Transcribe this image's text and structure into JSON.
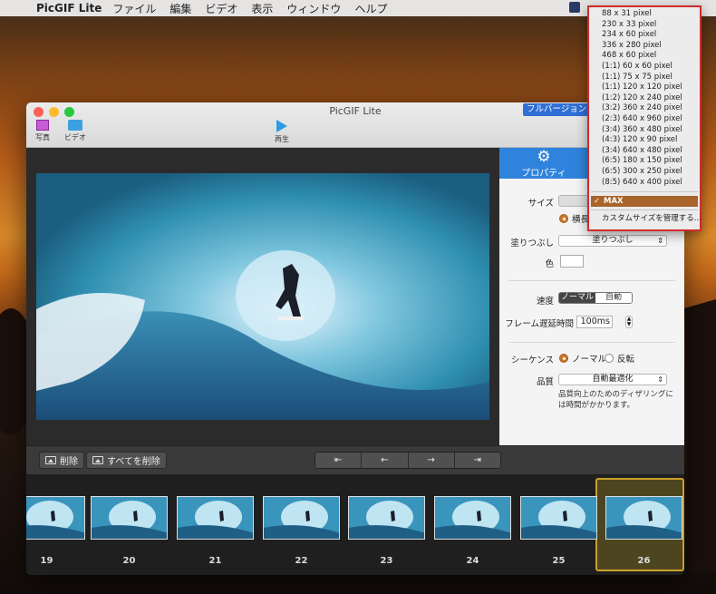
{
  "menubar": {
    "app_name": "PicGIF Lite",
    "items": [
      "ファイル",
      "編集",
      "ビデオ",
      "表示",
      "ウィンドウ",
      "ヘルプ"
    ]
  },
  "window": {
    "title": "PicGIF Lite",
    "upgrade_button": "フルバージョンへの",
    "toolbar": {
      "photo": "写真",
      "video": "ビデオ",
      "play": "再生"
    }
  },
  "panel": {
    "tab_properties": "プロパティ",
    "size_label": "サイズ",
    "size_radio": "横長",
    "fill_label": "塗りつぶし",
    "fill_value": "塗りつぶし",
    "color_label": "色",
    "speed_label": "速度",
    "speed_options": [
      "ノーマル",
      "自動"
    ],
    "frame_delay_label": "フレーム遅延時間",
    "frame_delay_value": "100",
    "frame_delay_unit": "ms",
    "sequence_label": "シーケンス",
    "sequence_normal": "ノーマル",
    "sequence_reverse": "反転",
    "quality_label": "品質",
    "quality_value": "自動最適化",
    "quality_note": "品質向上のためのディザリングには時間がかかります。"
  },
  "controls": {
    "delete": "削除",
    "delete_all": "すべてを削除",
    "nav": [
      "⇤",
      "←",
      "→",
      "⇥"
    ]
  },
  "timeline": {
    "frames": [
      "19",
      "20",
      "21",
      "22",
      "23",
      "24",
      "25",
      "26"
    ],
    "selected": "26"
  },
  "size_menu": {
    "items": [
      "88 x 31 pixel",
      "230 x 33 pixel",
      "234 x 60 pixel",
      "336 x 280 pixel",
      "468 x 60 pixel",
      "(1:1) 60 x 60 pixel",
      "(1:1) 75 x 75 pixel",
      "(1:1) 120 x 120 pixel",
      "(1:2) 120 x 240 pixel",
      "(3:2) 360 x 240 pixel",
      "(2:3) 640 x 960 pixel",
      "(3:4) 360 x 480 pixel",
      "(4:3) 120 x 90 pixel",
      "(3:4) 640 x 480 pixel",
      "(6:5) 180 x 150 pixel",
      "(6:5) 300 x 250 pixel",
      "(8:5) 640 x 400 pixel"
    ],
    "selected": "MAX",
    "manage": "カスタムサイズを管理する..."
  },
  "colors": {
    "accent": "#2f83dc",
    "menu_selected": "#a8642a",
    "frame_selected": "#c9a12a"
  }
}
